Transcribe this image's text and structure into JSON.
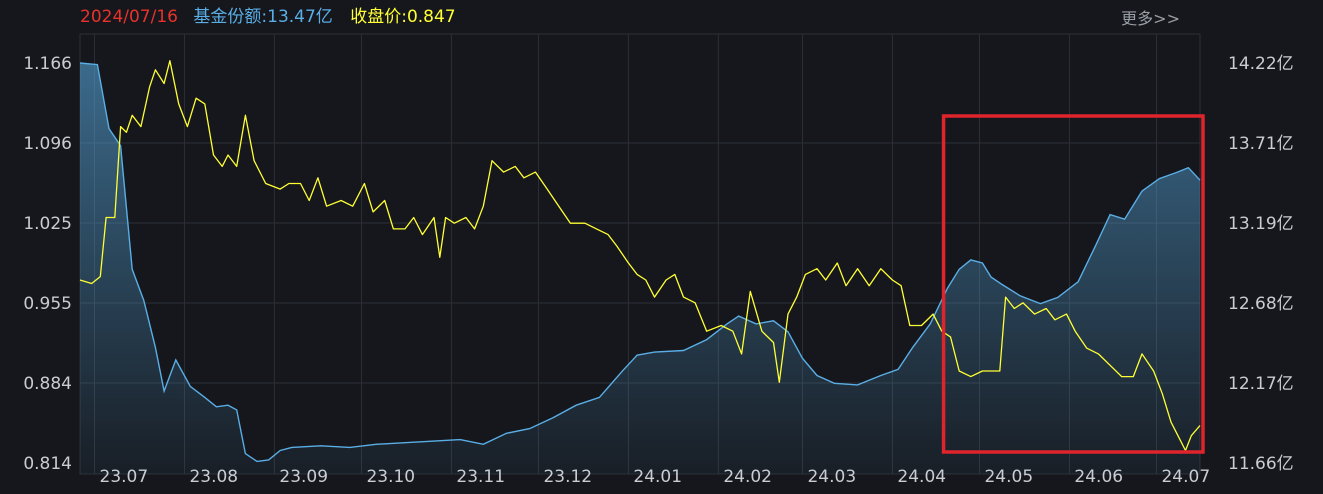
{
  "header": {
    "date": "2024/07/16",
    "share_label": "基金份额:",
    "share_value": "13.47亿",
    "close_label": "收盘价:",
    "close_value": "0.847",
    "more": "更多>>"
  },
  "colors": {
    "background": "#15171c",
    "grid": "#2c2f36",
    "date": "#e8322c",
    "share": "#5aaee6",
    "price": "#ffff33",
    "highlight_box": "#e0242c",
    "tick": "#c9ccd2"
  },
  "chart_data": {
    "type": "line",
    "title": "",
    "xlabel": "",
    "ylabel": "",
    "x_ticks": [
      "23.07",
      "23.08",
      "23.09",
      "23.10",
      "23.11",
      "23.12",
      "24.01",
      "24.02",
      "24.03",
      "24.04",
      "24.05",
      "24.06",
      "24.07"
    ],
    "x_range": [
      "2023-06-26",
      "2024-07-16"
    ],
    "y_left": {
      "ticks": [
        "1.166",
        "1.096",
        "1.025",
        "0.955",
        "0.884",
        "0.814"
      ],
      "range": [
        0.814,
        1.166
      ]
    },
    "y_right": {
      "ticks": [
        "14.22亿",
        "13.71亿",
        "13.19亿",
        "12.68亿",
        "12.17亿",
        "11.66亿"
      ],
      "range": [
        11.66,
        14.22
      ],
      "unit": "亿"
    },
    "grid": true,
    "highlight_range": [
      "2024-04-20",
      "2024-07-16"
    ],
    "series": [
      {
        "axis": "left",
        "style": "line",
        "points": [
          [
            "2023-06-26",
            0.975
          ],
          [
            "2023-06-30",
            0.972
          ],
          [
            "2023-07-03",
            0.978
          ],
          [
            "2023-07-05",
            1.03
          ],
          [
            "2023-07-08",
            1.03
          ],
          [
            "2023-07-10",
            1.11
          ],
          [
            "2023-07-12",
            1.105
          ],
          [
            "2023-07-14",
            1.12
          ],
          [
            "2023-07-17",
            1.11
          ],
          [
            "2023-07-20",
            1.145
          ],
          [
            "2023-07-22",
            1.16
          ],
          [
            "2023-07-25",
            1.148
          ],
          [
            "2023-07-27",
            1.168
          ],
          [
            "2023-07-30",
            1.13
          ],
          [
            "2023-08-02",
            1.11
          ],
          [
            "2023-08-05",
            1.135
          ],
          [
            "2023-08-08",
            1.13
          ],
          [
            "2023-08-11",
            1.085
          ],
          [
            "2023-08-14",
            1.075
          ],
          [
            "2023-08-16",
            1.085
          ],
          [
            "2023-08-19",
            1.075
          ],
          [
            "2023-08-22",
            1.12
          ],
          [
            "2023-08-25",
            1.08
          ],
          [
            "2023-08-29",
            1.06
          ],
          [
            "2023-09-03",
            1.055
          ],
          [
            "2023-09-06",
            1.06
          ],
          [
            "2023-09-10",
            1.06
          ],
          [
            "2023-09-13",
            1.045
          ],
          [
            "2023-09-16",
            1.065
          ],
          [
            "2023-09-19",
            1.04
          ],
          [
            "2023-09-24",
            1.045
          ],
          [
            "2023-09-28",
            1.04
          ],
          [
            "2023-10-02",
            1.06
          ],
          [
            "2023-10-05",
            1.035
          ],
          [
            "2023-10-09",
            1.045
          ],
          [
            "2023-10-12",
            1.02
          ],
          [
            "2023-10-16",
            1.02
          ],
          [
            "2023-10-19",
            1.03
          ],
          [
            "2023-10-22",
            1.015
          ],
          [
            "2023-10-26",
            1.03
          ],
          [
            "2023-10-28",
            0.995
          ],
          [
            "2023-10-30",
            1.03
          ],
          [
            "2023-11-02",
            1.025
          ],
          [
            "2023-11-06",
            1.03
          ],
          [
            "2023-11-09",
            1.02
          ],
          [
            "2023-11-12",
            1.04
          ],
          [
            "2023-11-15",
            1.08
          ],
          [
            "2023-11-19",
            1.07
          ],
          [
            "2023-11-23",
            1.075
          ],
          [
            "2023-11-26",
            1.065
          ],
          [
            "2023-11-30",
            1.07
          ],
          [
            "2023-12-04",
            1.055
          ],
          [
            "2023-12-08",
            1.04
          ],
          [
            "2023-12-12",
            1.025
          ],
          [
            "2023-12-17",
            1.025
          ],
          [
            "2023-12-21",
            1.02
          ],
          [
            "2023-12-25",
            1.015
          ],
          [
            "2023-12-28",
            1.005
          ],
          [
            "2024-01-01",
            0.99
          ],
          [
            "2024-01-04",
            0.98
          ],
          [
            "2024-01-07",
            0.975
          ],
          [
            "2024-01-10",
            0.96
          ],
          [
            "2024-01-14",
            0.975
          ],
          [
            "2024-01-17",
            0.98
          ],
          [
            "2024-01-20",
            0.96
          ],
          [
            "2024-01-24",
            0.955
          ],
          [
            "2024-01-28",
            0.93
          ],
          [
            "2024-02-02",
            0.935
          ],
          [
            "2024-02-06",
            0.93
          ],
          [
            "2024-02-09",
            0.91
          ],
          [
            "2024-02-12",
            0.965
          ],
          [
            "2024-02-16",
            0.93
          ],
          [
            "2024-02-20",
            0.92
          ],
          [
            "2024-02-22",
            0.885
          ],
          [
            "2024-02-25",
            0.945
          ],
          [
            "2024-02-28",
            0.96
          ],
          [
            "2024-03-02",
            0.98
          ],
          [
            "2024-03-06",
            0.985
          ],
          [
            "2024-03-09",
            0.975
          ],
          [
            "2024-03-13",
            0.99
          ],
          [
            "2024-03-16",
            0.97
          ],
          [
            "2024-03-20",
            0.985
          ],
          [
            "2024-03-24",
            0.97
          ],
          [
            "2024-03-28",
            0.985
          ],
          [
            "2024-04-01",
            0.975
          ],
          [
            "2024-04-04",
            0.97
          ],
          [
            "2024-04-07",
            0.935
          ],
          [
            "2024-04-11",
            0.935
          ],
          [
            "2024-04-15",
            0.945
          ],
          [
            "2024-04-18",
            0.93
          ],
          [
            "2024-04-21",
            0.925
          ],
          [
            "2024-04-24",
            0.895
          ],
          [
            "2024-04-28",
            0.89
          ],
          [
            "2024-05-02",
            0.895
          ],
          [
            "2024-05-08",
            0.895
          ],
          [
            "2024-05-10",
            0.96
          ],
          [
            "2024-05-13",
            0.95
          ],
          [
            "2024-05-16",
            0.955
          ],
          [
            "2024-05-20",
            0.945
          ],
          [
            "2024-05-24",
            0.95
          ],
          [
            "2024-05-27",
            0.94
          ],
          [
            "2024-05-31",
            0.945
          ],
          [
            "2024-06-03",
            0.93
          ],
          [
            "2024-06-07",
            0.915
          ],
          [
            "2024-06-11",
            0.91
          ],
          [
            "2024-06-15",
            0.9
          ],
          [
            "2024-06-19",
            0.89
          ],
          [
            "2024-06-23",
            0.89
          ],
          [
            "2024-06-26",
            0.91
          ],
          [
            "2024-06-30",
            0.895
          ],
          [
            "2024-07-03",
            0.875
          ],
          [
            "2024-07-06",
            0.85
          ],
          [
            "2024-07-09",
            0.835
          ],
          [
            "2024-07-11",
            0.825
          ],
          [
            "2024-07-13",
            0.838
          ],
          [
            "2024-07-16",
            0.847
          ]
        ]
      },
      {
        "axis": "right",
        "style": "area",
        "points": [
          [
            "2023-06-26",
            14.22
          ],
          [
            "2023-07-02",
            14.21
          ],
          [
            "2023-07-06",
            13.8
          ],
          [
            "2023-07-10",
            13.69
          ],
          [
            "2023-07-14",
            12.9
          ],
          [
            "2023-07-18",
            12.7
          ],
          [
            "2023-07-22",
            12.4
          ],
          [
            "2023-07-25",
            12.12
          ],
          [
            "2023-07-29",
            12.32
          ],
          [
            "2023-08-03",
            12.15
          ],
          [
            "2023-08-08",
            12.08
          ],
          [
            "2023-08-12",
            12.02
          ],
          [
            "2023-08-16",
            12.03
          ],
          [
            "2023-08-19",
            12.0
          ],
          [
            "2023-08-22",
            11.72
          ],
          [
            "2023-08-26",
            11.67
          ],
          [
            "2023-08-30",
            11.68
          ],
          [
            "2023-09-03",
            11.74
          ],
          [
            "2023-09-07",
            11.76
          ],
          [
            "2023-09-17",
            11.77
          ],
          [
            "2023-09-27",
            11.76
          ],
          [
            "2023-10-06",
            11.78
          ],
          [
            "2023-10-16",
            11.79
          ],
          [
            "2023-10-26",
            11.8
          ],
          [
            "2023-11-04",
            11.81
          ],
          [
            "2023-11-12",
            11.78
          ],
          [
            "2023-11-20",
            11.85
          ],
          [
            "2023-11-28",
            11.88
          ],
          [
            "2023-12-06",
            11.95
          ],
          [
            "2023-12-14",
            12.03
          ],
          [
            "2023-12-22",
            12.08
          ],
          [
            "2023-12-30",
            12.25
          ],
          [
            "2024-01-04",
            12.35
          ],
          [
            "2024-01-10",
            12.37
          ],
          [
            "2024-01-20",
            12.38
          ],
          [
            "2024-01-28",
            12.45
          ],
          [
            "2024-02-04",
            12.55
          ],
          [
            "2024-02-08",
            12.6
          ],
          [
            "2024-02-14",
            12.55
          ],
          [
            "2024-02-20",
            12.57
          ],
          [
            "2024-02-25",
            12.5
          ],
          [
            "2024-03-01",
            12.33
          ],
          [
            "2024-03-06",
            12.22
          ],
          [
            "2024-03-12",
            12.17
          ],
          [
            "2024-03-20",
            12.16
          ],
          [
            "2024-03-28",
            12.22
          ],
          [
            "2024-04-03",
            12.26
          ],
          [
            "2024-04-08",
            12.4
          ],
          [
            "2024-04-14",
            12.55
          ],
          [
            "2024-04-20",
            12.78
          ],
          [
            "2024-04-24",
            12.9
          ],
          [
            "2024-04-28",
            12.96
          ],
          [
            "2024-05-02",
            12.94
          ],
          [
            "2024-05-05",
            12.85
          ],
          [
            "2024-05-09",
            12.8
          ],
          [
            "2024-05-15",
            12.73
          ],
          [
            "2024-05-22",
            12.68
          ],
          [
            "2024-05-28",
            12.72
          ],
          [
            "2024-06-04",
            12.82
          ],
          [
            "2024-06-10",
            13.05
          ],
          [
            "2024-06-15",
            13.25
          ],
          [
            "2024-06-20",
            13.22
          ],
          [
            "2024-06-26",
            13.4
          ],
          [
            "2024-07-02",
            13.48
          ],
          [
            "2024-07-08",
            13.52
          ],
          [
            "2024-07-12",
            13.55
          ],
          [
            "2024-07-16",
            13.47
          ]
        ]
      }
    ]
  }
}
